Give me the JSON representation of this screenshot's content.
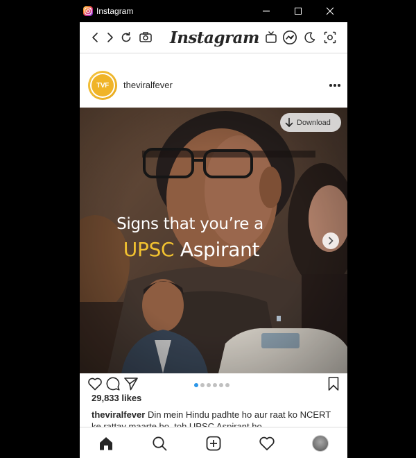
{
  "window": {
    "title": "Instagram",
    "icon": "instagram-app-icon"
  },
  "window_controls": [
    "minimize",
    "maximize",
    "close"
  ],
  "topnav": {
    "logo": "Instagram",
    "left_icons": [
      "back-icon",
      "forward-icon",
      "refresh-icon",
      "camera-icon"
    ],
    "right_icons": [
      "igtv-icon",
      "messenger-icon",
      "dark-mode-icon",
      "screenshot-icon"
    ]
  },
  "post": {
    "username": "theviralfever",
    "avatar_text": "TVF",
    "media": {
      "overlay_line1": "Signs that you’re a",
      "overlay_highlight": "UPSC",
      "overlay_rest": " Aspirant",
      "download_label": "Download",
      "highlight_color": "#f2c230"
    },
    "carousel": {
      "count": 6,
      "active_index": 0
    },
    "likes": "29,833 likes",
    "caption_user": "theviralfever",
    "caption_text": " Din mein Hindu padhte ho aur raat ko NCERT ke rattay maarte ho, toh UPSC Aspirant ho"
  },
  "bottomnav": {
    "items": [
      "home-icon",
      "search-icon",
      "new-post-icon",
      "activity-icon",
      "profile-avatar"
    ]
  },
  "colors": {
    "accent": "#2c96e8",
    "text": "#262626",
    "titlebar": "#000000"
  }
}
